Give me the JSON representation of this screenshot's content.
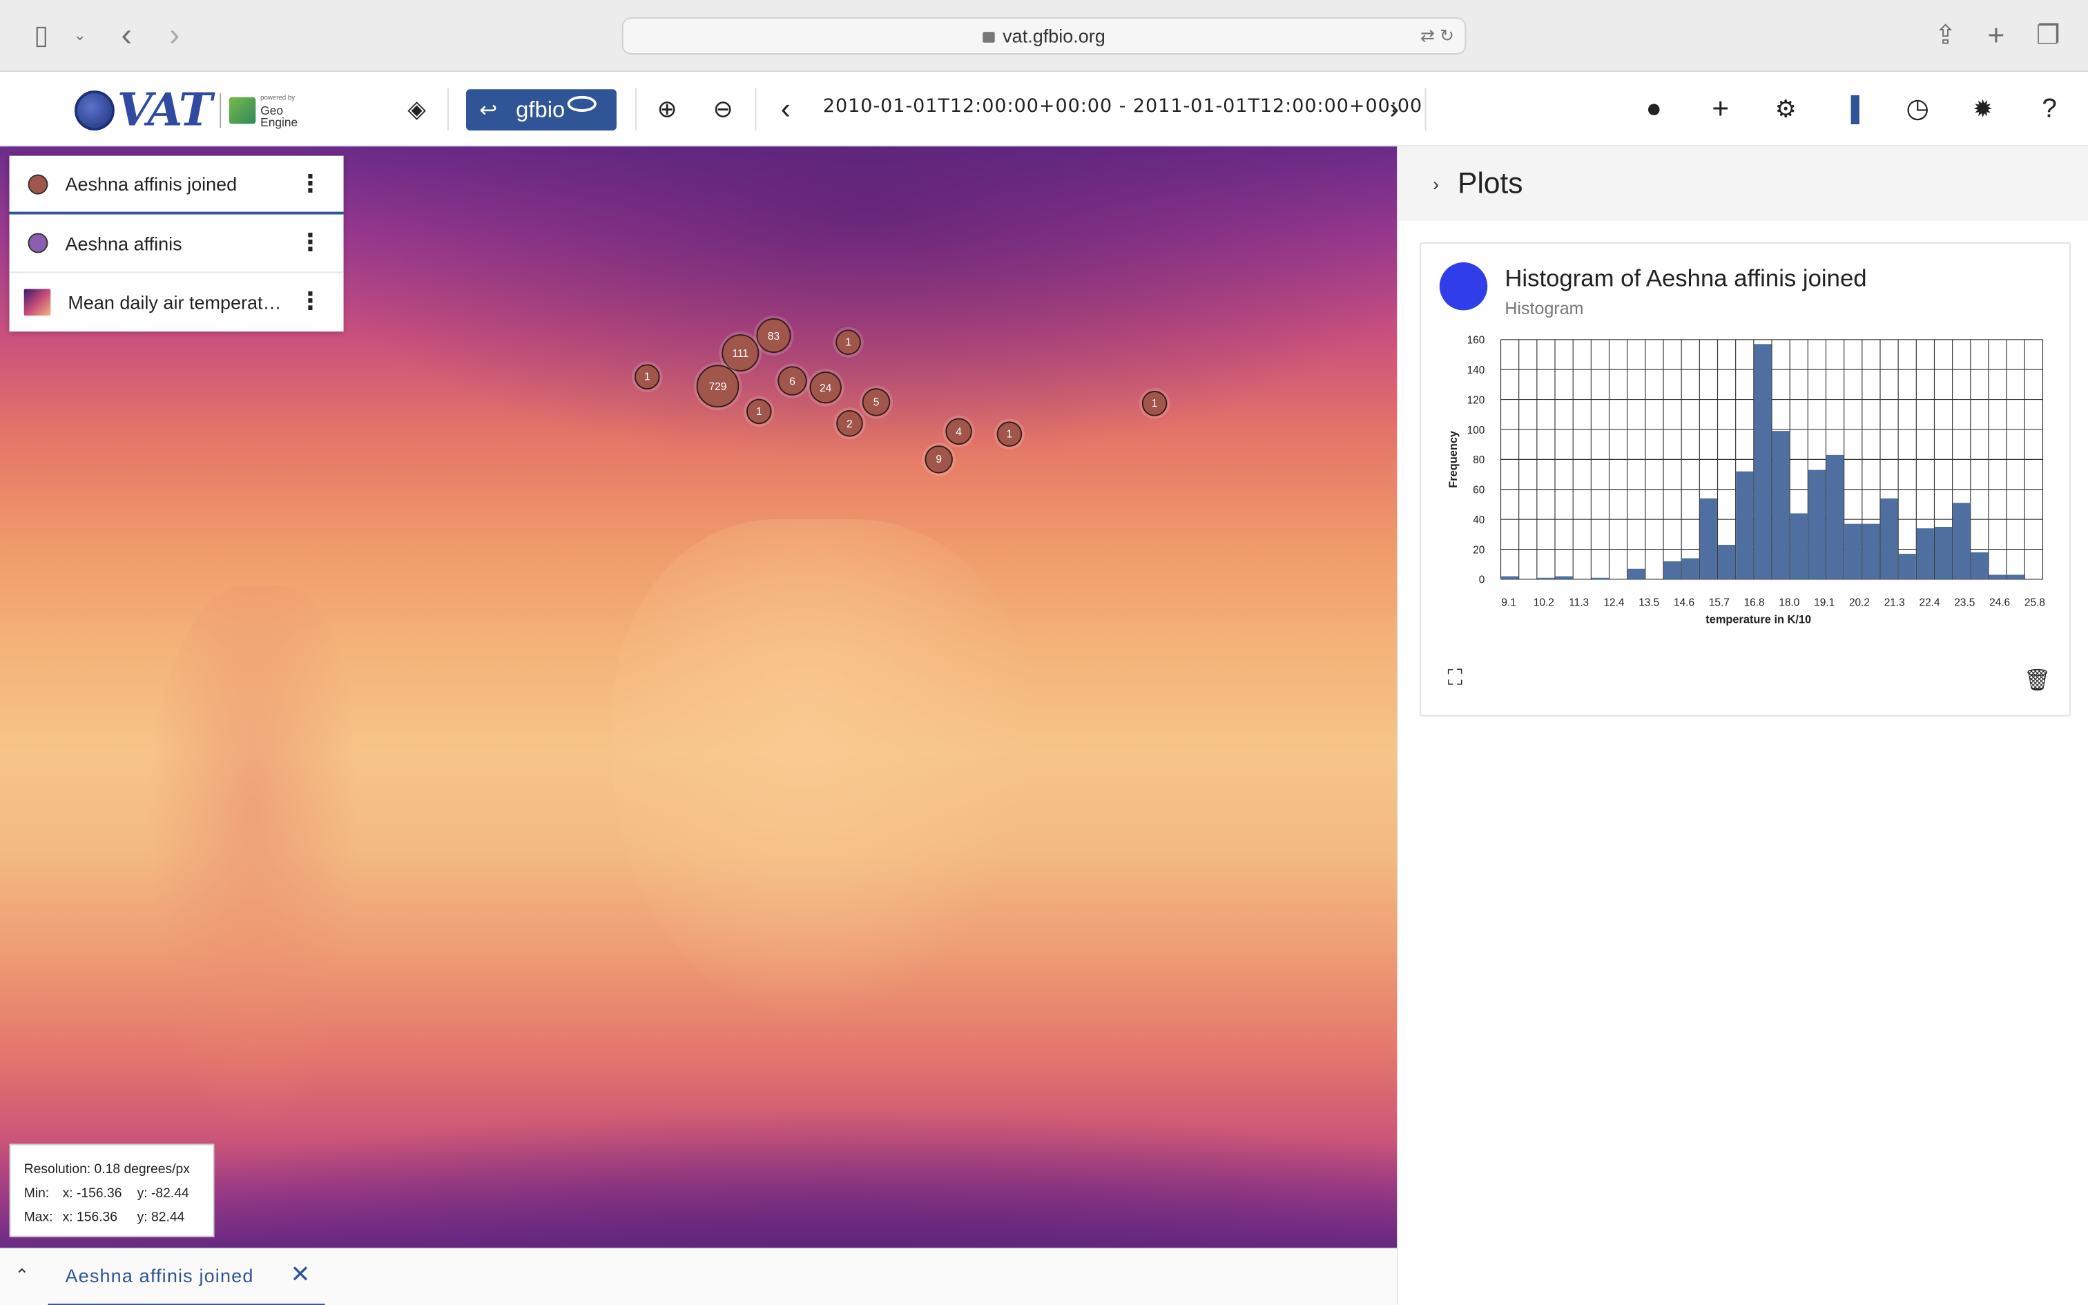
{
  "browser": {
    "url": "vat.gfbio.org"
  },
  "toolbar": {
    "logo_text": "VAT",
    "geo_small": "powered by",
    "geo_line1": "Geo",
    "geo_line2": "Engine",
    "gfbio_label": "gfbio",
    "time_range": "2010-01-01T12:00:00+00:00 - 2011-01-01T12:00:00+00:00"
  },
  "layers": [
    {
      "name": "Aeshna affinis joined",
      "color": "#a0564a"
    },
    {
      "name": "Aeshna affinis",
      "color": "#8a5fb0"
    },
    {
      "name": "Mean daily air temperatu…",
      "color": "raster"
    }
  ],
  "clusters": [
    {
      "label": "83"
    },
    {
      "label": "1"
    },
    {
      "label": "111"
    },
    {
      "label": "1"
    },
    {
      "label": "729"
    },
    {
      "label": "6"
    },
    {
      "label": "24"
    },
    {
      "label": "1"
    },
    {
      "label": "5"
    },
    {
      "label": "2"
    },
    {
      "label": "4"
    },
    {
      "label": "1"
    },
    {
      "label": "9"
    },
    {
      "label": "1"
    }
  ],
  "info": {
    "resolution": "Resolution: 0.18 degrees/px",
    "min_label": "Min:",
    "min_x": "x: -156.36",
    "min_y": "y: -82.44",
    "max_label": "Max:",
    "max_x": "x: 156.36",
    "max_y": "y: 82.44"
  },
  "bottom_tab": {
    "label": "Aeshna affinis joined"
  },
  "panel": {
    "title": "Plots",
    "plot_title": "Histogram of Aeshna affinis joined",
    "plot_subtitle": "Histogram"
  },
  "chart_data": {
    "type": "bar",
    "title": "",
    "xlabel": "temperature in K/10",
    "ylabel": "Frequency",
    "ylim": [
      0,
      160
    ],
    "yticks": [
      0,
      20,
      40,
      60,
      80,
      100,
      120,
      140,
      160
    ],
    "xtick_labels": [
      "9.1",
      "10.2",
      "11.3",
      "12.4",
      "13.5",
      "14.6",
      "15.7",
      "16.8",
      "18.0",
      "19.1",
      "20.2",
      "21.3",
      "22.4",
      "23.5",
      "24.6",
      "25.8"
    ],
    "bins": 30,
    "values": [
      2,
      0,
      1,
      2,
      0,
      1,
      0,
      7,
      0,
      12,
      14,
      54,
      23,
      72,
      157,
      99,
      44,
      73,
      83,
      37,
      37,
      54,
      17,
      34,
      35,
      51,
      18,
      3,
      3,
      0
    ],
    "color": "#4e6fa0"
  }
}
